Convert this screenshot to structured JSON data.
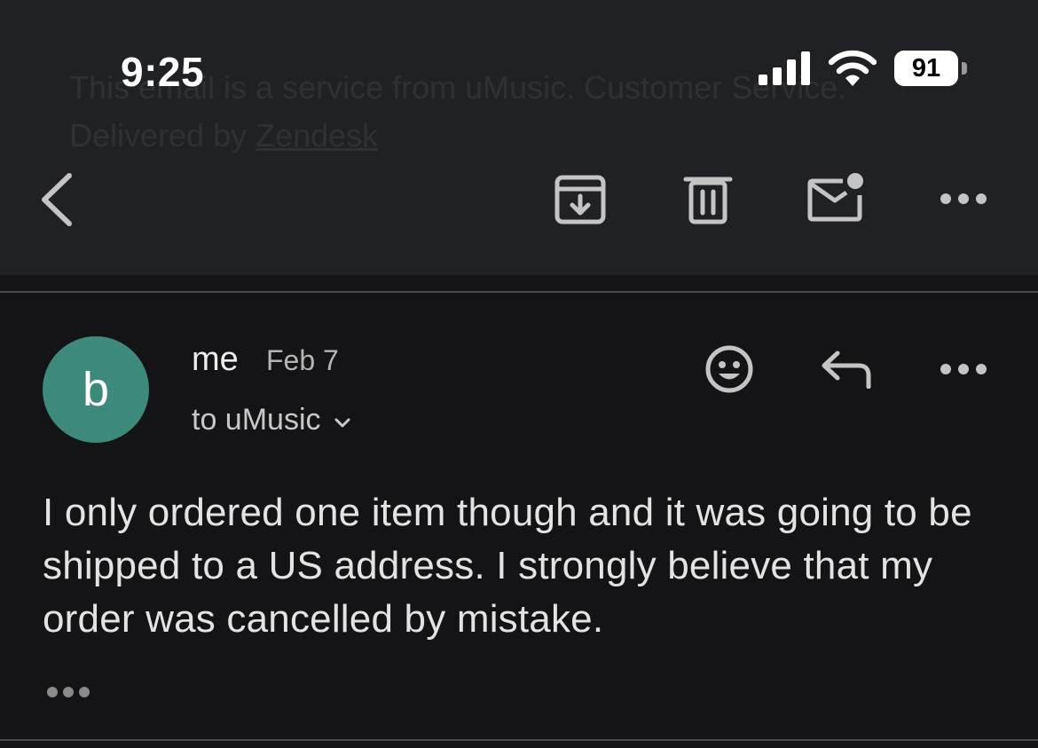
{
  "background_text": {
    "line1": "This email is a service from uMusic. Customer Service.",
    "line2_prefix": "Delivered by",
    "line2_link": "Zendesk"
  },
  "status_bar": {
    "time": "9:25",
    "battery": "91",
    "icons": [
      "signal-icon",
      "wifi-icon",
      "battery-icon"
    ]
  },
  "toolbar": {
    "icons": [
      "back-icon",
      "archive-icon",
      "trash-icon",
      "mark-unread-icon",
      "more-options-icon"
    ]
  },
  "message": {
    "avatar_letter": "b",
    "avatar_color": "#3d8a7c",
    "sender": "me",
    "date": "Feb 7",
    "recipients": "to uMusic",
    "body": "I only ordered one item though and it was going to be shipped to a US address. I strongly believe that my order was cancelled by mistake.",
    "actions": [
      "emoji-reaction-icon",
      "reply-icon",
      "more-options-icon"
    ]
  },
  "colors": {
    "toolbar_bg": "#202124",
    "page_bg": "#141416",
    "icon": "#c4c4c4"
  }
}
